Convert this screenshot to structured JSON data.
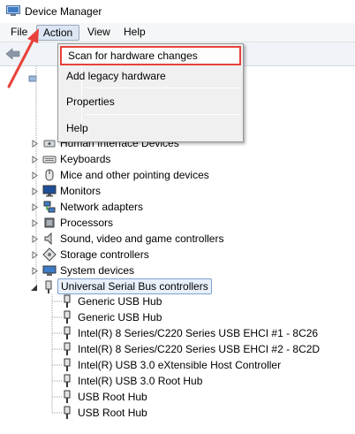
{
  "window": {
    "title": "Device Manager"
  },
  "menubar": {
    "items": [
      {
        "label": "File"
      },
      {
        "label": "Action"
      },
      {
        "label": "View"
      },
      {
        "label": "Help"
      }
    ]
  },
  "dropdown": {
    "items": [
      {
        "label": "Scan for hardware changes"
      },
      {
        "label": "Add legacy hardware"
      },
      {
        "label": "Properties"
      },
      {
        "label": "Help"
      }
    ]
  },
  "tree": {
    "categories": [
      {
        "label": "Human Interface Devices",
        "icon": "hid-icon",
        "expanded": false
      },
      {
        "label": "Keyboards",
        "icon": "keyboard-icon",
        "expanded": false
      },
      {
        "label": "Mice and other pointing devices",
        "icon": "mouse-icon",
        "expanded": false
      },
      {
        "label": "Monitors",
        "icon": "monitor-icon",
        "expanded": false
      },
      {
        "label": "Network adapters",
        "icon": "network-icon",
        "expanded": false
      },
      {
        "label": "Processors",
        "icon": "processor-icon",
        "expanded": false
      },
      {
        "label": "Sound, video and game controllers",
        "icon": "speaker-icon",
        "expanded": false
      },
      {
        "label": "Storage controllers",
        "icon": "storage-icon",
        "expanded": false
      },
      {
        "label": "System devices",
        "icon": "system-icon",
        "expanded": false
      },
      {
        "label": "Universal Serial Bus controllers",
        "icon": "usb-icon",
        "expanded": true
      }
    ],
    "usb_children": [
      {
        "label": "Generic USB Hub"
      },
      {
        "label": "Generic USB Hub"
      },
      {
        "label": "Intel(R) 8 Series/C220 Series USB EHCI #1 - 8C26"
      },
      {
        "label": "Intel(R) 8 Series/C220 Series USB EHCI #2 - 8C2D"
      },
      {
        "label": "Intel(R) USB 3.0 eXtensible Host Controller"
      },
      {
        "label": "Intel(R) USB 3.0 Root Hub"
      },
      {
        "label": "USB Root Hub"
      },
      {
        "label": "USB Root Hub"
      }
    ]
  },
  "colors": {
    "highlight_border": "#e8413a",
    "arrow": "#e8413a",
    "selection_border": "#7da2ce"
  }
}
